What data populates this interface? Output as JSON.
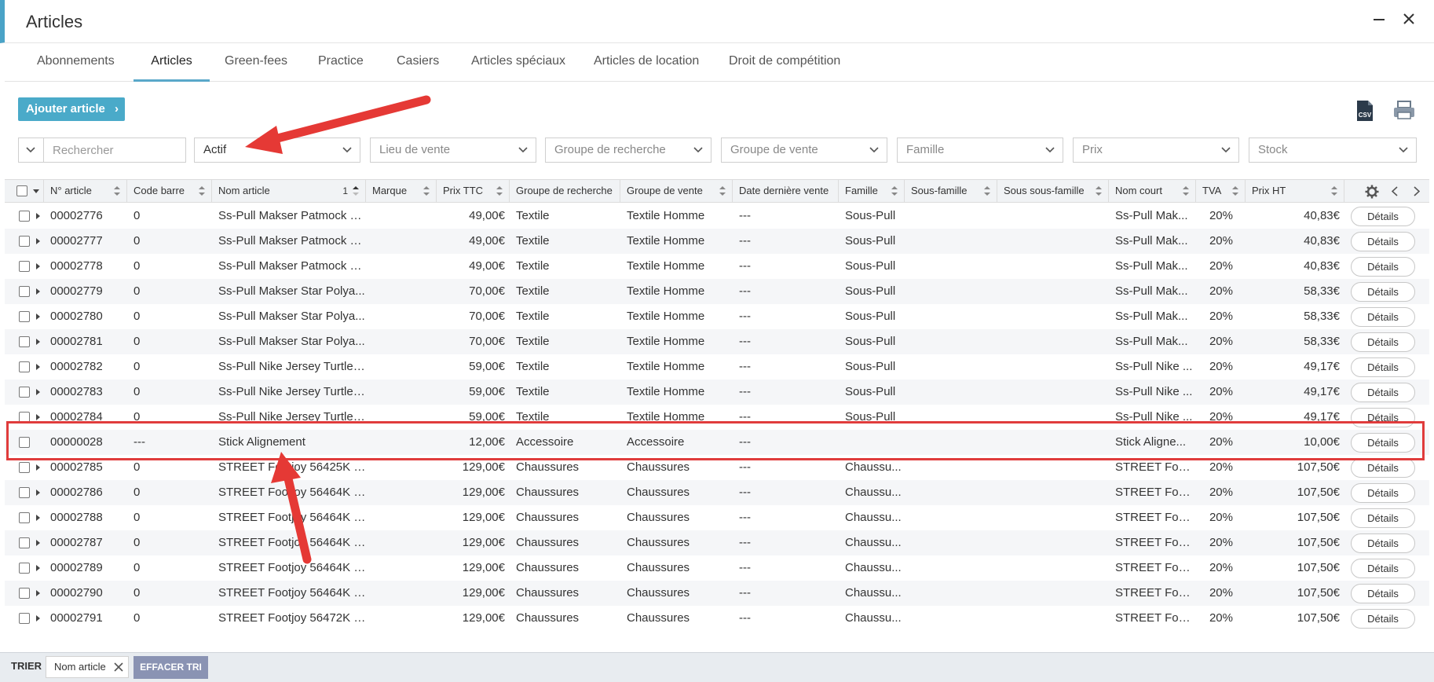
{
  "window": {
    "title": "Articles"
  },
  "tabs": [
    {
      "label": "Abonnements"
    },
    {
      "label": "Articles"
    },
    {
      "label": "Green-fees"
    },
    {
      "label": "Practice"
    },
    {
      "label": "Casiers"
    },
    {
      "label": "Articles spéciaux"
    },
    {
      "label": "Articles de location"
    },
    {
      "label": "Droit de compétition"
    }
  ],
  "active_tab": "Articles",
  "toolbar": {
    "add_label": "Ajouter article"
  },
  "filters": {
    "search_placeholder": "Rechercher",
    "status": "Actif",
    "lieu": "Lieu de vente",
    "groupe_recherche": "Groupe de recherche",
    "groupe_vente": "Groupe de vente",
    "famille": "Famille",
    "prix": "Prix",
    "stock": "Stock"
  },
  "columns": {
    "num": "N° article",
    "code": "Code barre",
    "nom": "Nom article",
    "nom_sort_index": "1",
    "marque": "Marque",
    "prix_ttc": "Prix TTC",
    "groupe_recherche": "Groupe de recherche",
    "groupe_vente": "Groupe de vente",
    "date": "Date dernière vente",
    "famille": "Famille",
    "sous_famille": "Sous-famille",
    "sous_sous_famille": "Sous sous-famille",
    "nom_court": "Nom court",
    "tva": "TVA",
    "prix_ht": "Prix HT"
  },
  "rows": [
    {
      "num": "00002776",
      "code": "0",
      "nom": "Ss-Pull Makser Patmock C...",
      "prix_ttc": "49,00€",
      "gr": "Textile",
      "gv": "Textile Homme",
      "date": "---",
      "famille": "Sous-Pull",
      "nom_court": "Ss-Pull Mak...",
      "tva": "20%",
      "prix_ht": "40,83€",
      "details": "Détails"
    },
    {
      "num": "00002777",
      "code": "0",
      "nom": "Ss-Pull Makser Patmock C...",
      "prix_ttc": "49,00€",
      "gr": "Textile",
      "gv": "Textile Homme",
      "date": "---",
      "famille": "Sous-Pull",
      "nom_court": "Ss-Pull Mak...",
      "tva": "20%",
      "prix_ht": "40,83€",
      "details": "Détails"
    },
    {
      "num": "00002778",
      "code": "0",
      "nom": "Ss-Pull Makser Patmock C...",
      "prix_ttc": "49,00€",
      "gr": "Textile",
      "gv": "Textile Homme",
      "date": "---",
      "famille": "Sous-Pull",
      "nom_court": "Ss-Pull Mak...",
      "tva": "20%",
      "prix_ht": "40,83€",
      "details": "Détails"
    },
    {
      "num": "00002779",
      "code": "0",
      "nom": "Ss-Pull Makser Star Polya...",
      "prix_ttc": "70,00€",
      "gr": "Textile",
      "gv": "Textile Homme",
      "date": "---",
      "famille": "Sous-Pull",
      "nom_court": "Ss-Pull Mak...",
      "tva": "20%",
      "prix_ht": "58,33€",
      "details": "Détails"
    },
    {
      "num": "00002780",
      "code": "0",
      "nom": "Ss-Pull Makser Star Polya...",
      "prix_ttc": "70,00€",
      "gr": "Textile",
      "gv": "Textile Homme",
      "date": "---",
      "famille": "Sous-Pull",
      "nom_court": "Ss-Pull Mak...",
      "tva": "20%",
      "prix_ht": "58,33€",
      "details": "Détails"
    },
    {
      "num": "00002781",
      "code": "0",
      "nom": "Ss-Pull Makser Star Polya...",
      "prix_ttc": "70,00€",
      "gr": "Textile",
      "gv": "Textile Homme",
      "date": "---",
      "famille": "Sous-Pull",
      "nom_court": "Ss-Pull Mak...",
      "tva": "20%",
      "prix_ht": "58,33€",
      "details": "Détails"
    },
    {
      "num": "00002782",
      "code": "0",
      "nom": "Ss-Pull Nike Jersey Turtle ...",
      "prix_ttc": "59,00€",
      "gr": "Textile",
      "gv": "Textile Homme",
      "date": "---",
      "famille": "Sous-Pull",
      "nom_court": "Ss-Pull Nike ...",
      "tva": "20%",
      "prix_ht": "49,17€",
      "details": "Détails"
    },
    {
      "num": "00002783",
      "code": "0",
      "nom": "Ss-Pull Nike Jersey Turtle ...",
      "prix_ttc": "59,00€",
      "gr": "Textile",
      "gv": "Textile Homme",
      "date": "---",
      "famille": "Sous-Pull",
      "nom_court": "Ss-Pull Nike ...",
      "tva": "20%",
      "prix_ht": "49,17€",
      "details": "Détails"
    },
    {
      "num": "00002784",
      "code": "0",
      "nom": "Ss-Pull Nike Jersey Turtle ...",
      "prix_ttc": "59,00€",
      "gr": "Textile",
      "gv": "Textile Homme",
      "date": "---",
      "famille": "Sous-Pull",
      "nom_court": "Ss-Pull Nike ...",
      "tva": "20%",
      "prix_ht": "49,17€",
      "details": "Détails"
    },
    {
      "num": "00000028",
      "code": "---",
      "nom": "Stick Alignement",
      "prix_ttc": "12,00€",
      "gr": "Accessoire",
      "gv": "Accessoire",
      "date": "---",
      "famille": "",
      "nom_court": "Stick Aligne...",
      "tva": "20%",
      "prix_ht": "10,00€",
      "details": "Détails"
    },
    {
      "num": "00002785",
      "code": "0",
      "nom": "STREET Footjoy 56425K H...",
      "prix_ttc": "129,00€",
      "gr": "Chaussures",
      "gv": "Chaussures",
      "date": "---",
      "famille": "Chaussu...",
      "nom_court": "STREET Foot...",
      "tva": "20%",
      "prix_ht": "107,50€",
      "details": "Détails"
    },
    {
      "num": "00002786",
      "code": "0",
      "nom": "STREET Footjoy 56464K H...",
      "prix_ttc": "129,00€",
      "gr": "Chaussures",
      "gv": "Chaussures",
      "date": "---",
      "famille": "Chaussu...",
      "nom_court": "STREET Foot...",
      "tva": "20%",
      "prix_ht": "107,50€",
      "details": "Détails"
    },
    {
      "num": "00002788",
      "code": "0",
      "nom": "STREET Footjoy 56464K H...",
      "prix_ttc": "129,00€",
      "gr": "Chaussures",
      "gv": "Chaussures",
      "date": "---",
      "famille": "Chaussu...",
      "nom_court": "STREET Foot...",
      "tva": "20%",
      "prix_ht": "107,50€",
      "details": "Détails"
    },
    {
      "num": "00002787",
      "code": "0",
      "nom": "STREET Footjoy 56464K H...",
      "prix_ttc": "129,00€",
      "gr": "Chaussures",
      "gv": "Chaussures",
      "date": "---",
      "famille": "Chaussu...",
      "nom_court": "STREET Foot...",
      "tva": "20%",
      "prix_ht": "107,50€",
      "details": "Détails"
    },
    {
      "num": "00002789",
      "code": "0",
      "nom": "STREET Footjoy 56464K H...",
      "prix_ttc": "129,00€",
      "gr": "Chaussures",
      "gv": "Chaussures",
      "date": "---",
      "famille": "Chaussu...",
      "nom_court": "STREET Foot...",
      "tva": "20%",
      "prix_ht": "107,50€",
      "details": "Détails"
    },
    {
      "num": "00002790",
      "code": "0",
      "nom": "STREET Footjoy 56464K H...",
      "prix_ttc": "129,00€",
      "gr": "Chaussures",
      "gv": "Chaussures",
      "date": "---",
      "famille": "Chaussu...",
      "nom_court": "STREET Foot...",
      "tva": "20%",
      "prix_ht": "107,50€",
      "details": "Détails"
    },
    {
      "num": "00002791",
      "code": "0",
      "nom": "STREET Footjoy 56472K H...",
      "prix_ttc": "129,00€",
      "gr": "Chaussures",
      "gv": "Chaussures",
      "date": "---",
      "famille": "Chaussu...",
      "nom_court": "STREET Foot...",
      "tva": "20%",
      "prix_ht": "107,50€",
      "details": "Détails"
    }
  ],
  "highlighted_row": "00000028",
  "statusbar": {
    "sort_label": "TRIER",
    "sort_chip": "Nom article",
    "clear_label": "EFFACER TRI"
  },
  "icons": [
    "close-icon",
    "minimize-icon",
    "csv-icon",
    "print-icon",
    "gear-icon",
    "chevron-left-icon",
    "chevron-right-icon"
  ],
  "colors": {
    "accent": "#4aaac9",
    "highlight": "#e03c3c",
    "annotation_arrow": "#e53935",
    "clear_button": "#8a93b3"
  }
}
